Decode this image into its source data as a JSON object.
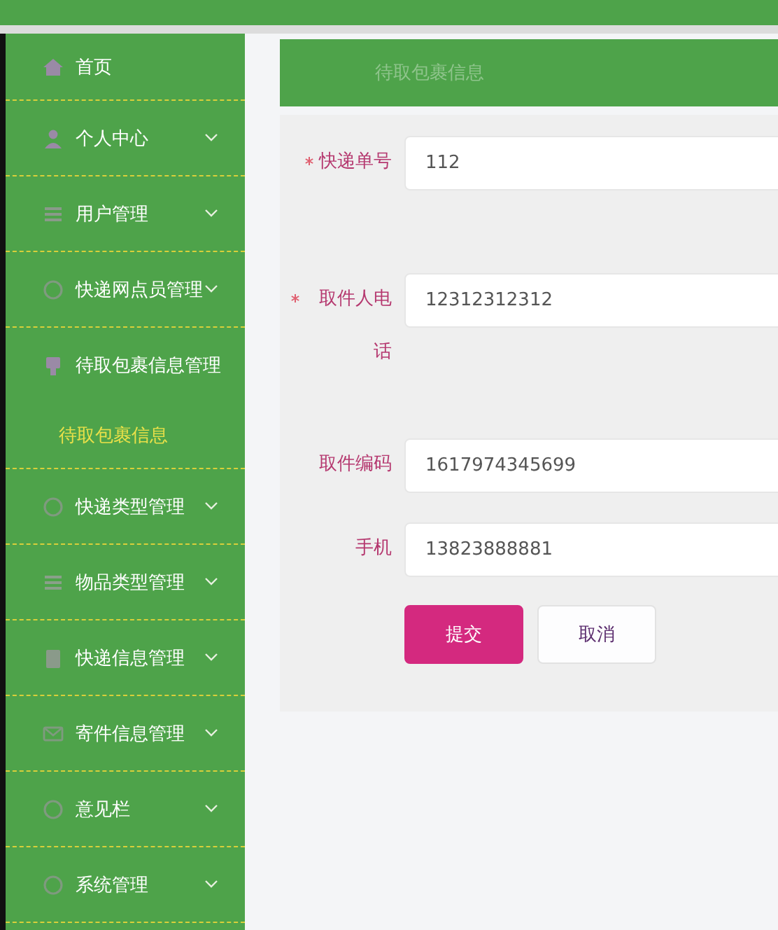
{
  "sidebar": {
    "items": [
      {
        "label": "首页",
        "kind": "link"
      },
      {
        "label": "个人中心",
        "kind": "menu",
        "expanded": false
      },
      {
        "label": "用户管理",
        "kind": "menu",
        "expanded": false
      },
      {
        "label": "快递网点员管理",
        "kind": "menu",
        "expanded": false
      },
      {
        "label": "待取包裹信息管理",
        "kind": "menu",
        "expanded": true,
        "children": [
          {
            "label": "待取包裹信息",
            "selected": true
          }
        ]
      },
      {
        "label": "快递类型管理",
        "kind": "menu",
        "expanded": false
      },
      {
        "label": "物品类型管理",
        "kind": "menu",
        "expanded": false
      },
      {
        "label": "快递信息管理",
        "kind": "menu",
        "expanded": false
      },
      {
        "label": "寄件信息管理",
        "kind": "menu",
        "expanded": false
      },
      {
        "label": "意见栏",
        "kind": "menu",
        "expanded": false
      },
      {
        "label": "系统管理",
        "kind": "menu",
        "expanded": false
      }
    ]
  },
  "breadcrumb": "待取包裹信息",
  "form": {
    "fields": [
      {
        "label": "快递单号",
        "value": "112",
        "required": true
      },
      {
        "label": "取件人电话",
        "value": "12312312312",
        "required": true
      },
      {
        "label": "取件编码",
        "value": "1617974345699",
        "required": false
      },
      {
        "label": "手机",
        "value": "13823888881",
        "required": false
      }
    ],
    "buttons": [
      {
        "label": "提交",
        "kind": "primary"
      },
      {
        "label": "取消",
        "kind": "default"
      }
    ]
  }
}
